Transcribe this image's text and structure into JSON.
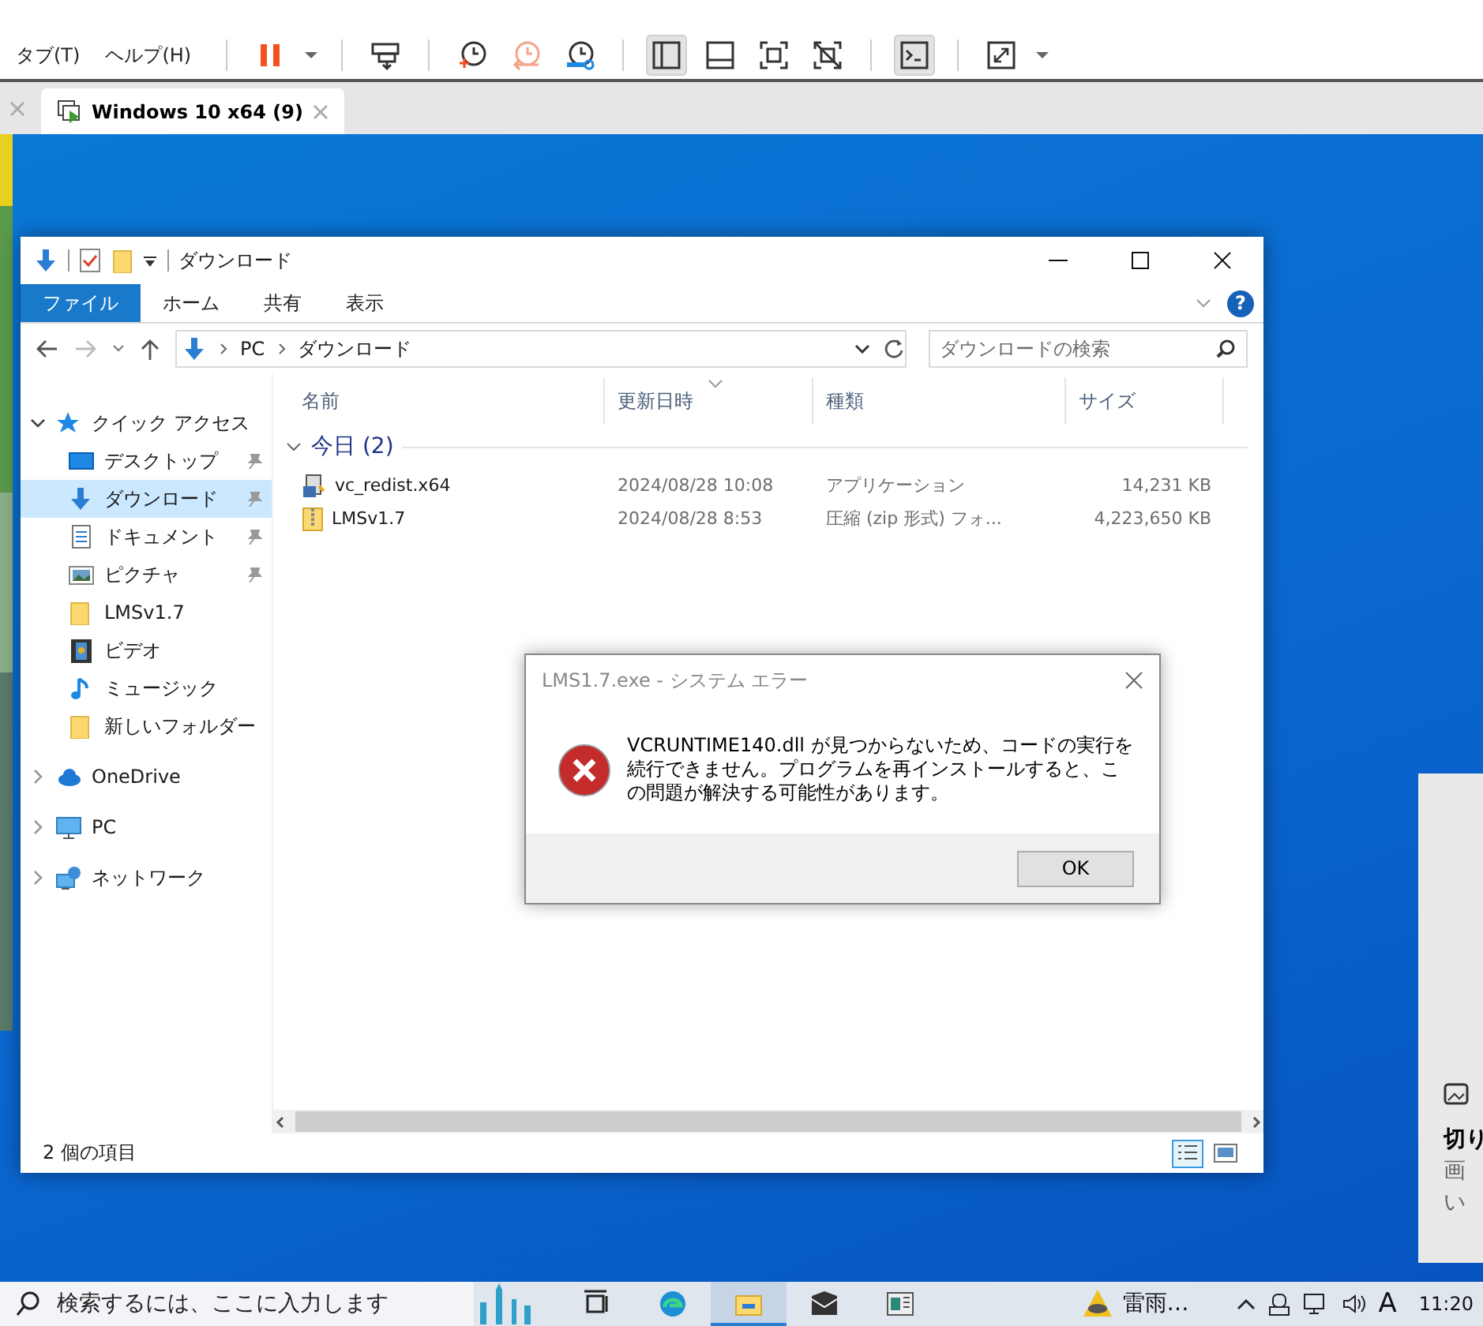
{
  "app_menu": [
    {
      "label": "タブ(T)"
    },
    {
      "label": "ヘルプ(H)"
    }
  ],
  "toolbar": [
    {
      "kind": "pause",
      "pressed": false
    },
    {
      "kind": "send-keys",
      "pressed": false
    },
    {
      "kind": "snapshot",
      "pressed": false
    },
    {
      "kind": "revert",
      "pressed": false
    },
    {
      "kind": "snapshot-manager",
      "pressed": false
    },
    {
      "kind": "sidebar",
      "pressed": true
    },
    {
      "kind": "bottom-panel",
      "pressed": false
    },
    {
      "kind": "full-screen",
      "pressed": false
    },
    {
      "kind": "unity",
      "pressed": false
    },
    {
      "kind": "console",
      "pressed": true
    },
    {
      "kind": "stretch",
      "pressed": false
    }
  ],
  "vm_tabs": [
    {
      "label": "Windows 10 x64 (9)",
      "selected": true
    }
  ],
  "explorer": {
    "title": "ダウンロード",
    "ribbon_tabs": [
      {
        "label": "ファイル",
        "selected": true
      },
      {
        "label": "ホーム",
        "selected": false
      },
      {
        "label": "共有",
        "selected": false
      },
      {
        "label": "表示",
        "selected": false
      }
    ],
    "breadcrumb": [
      "PC",
      "ダウンロード"
    ],
    "search": {
      "placeholder": "ダウンロードの検索"
    },
    "help": "?",
    "nav": [
      {
        "label": "クイック アクセス",
        "kind": "star",
        "expanded": true,
        "selected": false,
        "children": [
          {
            "label": "デスクトップ",
            "kind": "desktop",
            "pinned": true,
            "selected": false
          },
          {
            "label": "ダウンロード",
            "kind": "download",
            "pinned": true,
            "selected": true
          },
          {
            "label": "ドキュメント",
            "kind": "document",
            "pinned": true,
            "selected": false
          },
          {
            "label": "ピクチャ",
            "kind": "picture",
            "pinned": true,
            "selected": false
          },
          {
            "label": "LMSv1.7",
            "kind": "folder",
            "pinned": false,
            "selected": false
          },
          {
            "label": "ビデオ",
            "kind": "video",
            "pinned": false,
            "selected": false
          },
          {
            "label": "ミュージック",
            "kind": "music",
            "pinned": false,
            "selected": false
          },
          {
            "label": "新しいフォルダー",
            "kind": "folder",
            "pinned": false,
            "selected": false
          }
        ]
      },
      {
        "label": "OneDrive",
        "kind": "cloud",
        "expanded": false,
        "selected": false
      },
      {
        "label": "PC",
        "kind": "pc",
        "expanded": false,
        "selected": false
      },
      {
        "label": "ネットワーク",
        "kind": "network",
        "expanded": false,
        "selected": false
      }
    ],
    "columns": [
      {
        "label": "名前",
        "sorted": false
      },
      {
        "label": "更新日時",
        "sorted": true
      },
      {
        "label": "種類",
        "sorted": false
      },
      {
        "label": "サイズ",
        "sorted": false
      }
    ],
    "group": {
      "label": "今日 (2)",
      "expanded": true
    },
    "rows": [
      {
        "kind": "installer",
        "name": "vc_redist.x64",
        "date": "2024/08/28 10:08",
        "type": "アプリケーション",
        "size": "14,231 KB"
      },
      {
        "kind": "zip",
        "name": "LMSv1.7",
        "date": "2024/08/28 8:53",
        "type": "圧縮 (zip 形式) フォ...",
        "size": "4,223,650 KB"
      }
    ],
    "status": "2 個の項目",
    "views": [
      {
        "kind": "details",
        "selected": true
      },
      {
        "kind": "large-icons",
        "selected": false
      }
    ]
  },
  "dialog": {
    "title": "LMS1.7.exe - システム エラー",
    "message": "VCRUNTIME140.dll が見つからないため、コードの実行を続行できません。プログラムを再インストールすると、この問題が解決する可能性があります。",
    "button": "OK"
  },
  "notification": {
    "title": "切り",
    "lines": [
      "画",
      "い"
    ]
  },
  "taskbar": {
    "search": {
      "placeholder": "検索するには、ここに入力します"
    },
    "apps": [
      {
        "kind": "task-view",
        "active": false
      },
      {
        "kind": "edge",
        "active": false
      },
      {
        "kind": "explorer",
        "active": true
      },
      {
        "kind": "mail",
        "active": false
      },
      {
        "kind": "news",
        "active": false
      }
    ],
    "weather": "雷雨…",
    "ime": "A",
    "time": "11:20"
  }
}
